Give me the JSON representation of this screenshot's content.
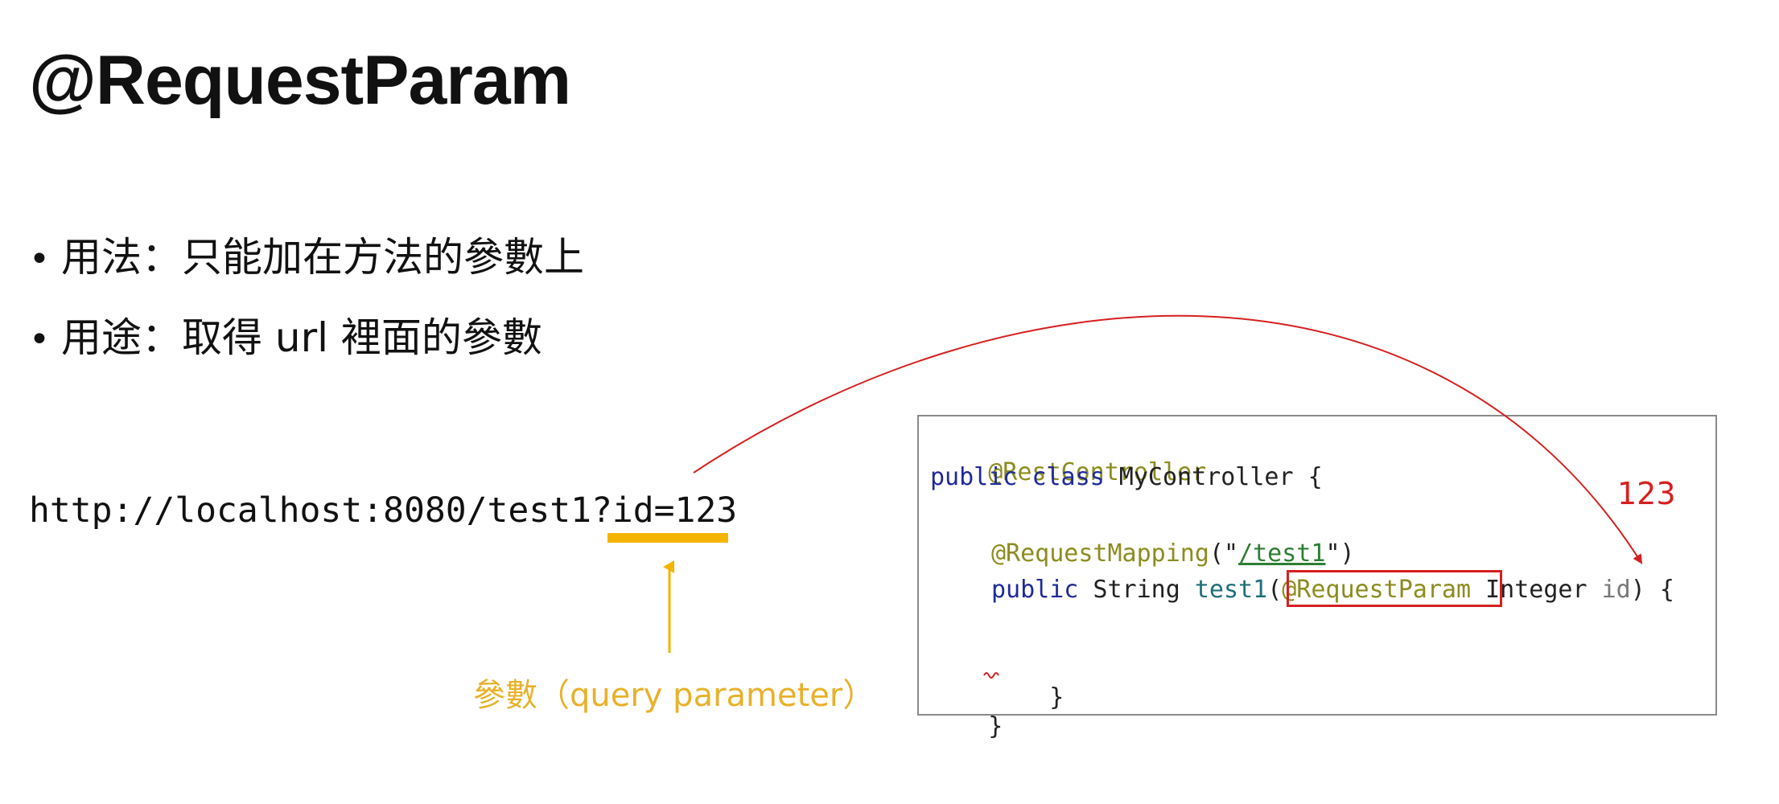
{
  "slide": {
    "title": "@RequestParam",
    "bullets": [
      {
        "marker": "•",
        "text": "用法：只能加在方法的參數上"
      },
      {
        "marker": "•",
        "text": "用途：取得 url 裡面的參數"
      }
    ],
    "url": "http://localhost:8080/test1?id=123",
    "parameter_caption": "參數（query parameter）",
    "value_label": "123"
  },
  "code": {
    "line1_annotation": "@RestController",
    "line2_kw1": "public",
    "line2_kw2": "class",
    "line2_rest": " MyController {",
    "line3_annotation": "@RequestMapping",
    "line3_open": "(\"",
    "line3_path": "/test1",
    "line3_close": "\")",
    "line4_kw": "public",
    "line4_type": " String ",
    "line4_method": "test1",
    "line4_paren": "(",
    "line4_annotation": "@RequestParam",
    "line4_type2": " Integer ",
    "line4_param": "id",
    "line4_end": ") {",
    "line5_brace": "}",
    "line6_brace": "}"
  },
  "colors": {
    "annotation": "#8c8c20",
    "keyword": "#1f2a9a",
    "highlight_box": "#d61f1f",
    "arrow": "#d61f1f",
    "url_underline": "#f4b400",
    "caption": "#e8b12a"
  }
}
